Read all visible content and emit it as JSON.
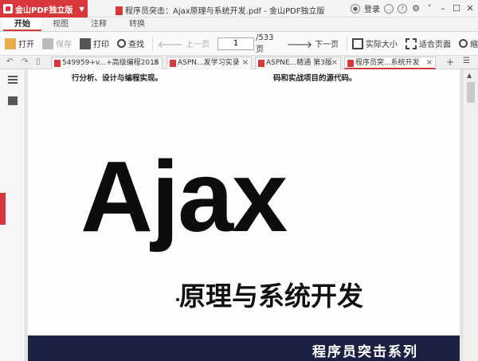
{
  "app": {
    "name": "金山PDF独立版",
    "window_title": "程序员突击：Ajax原理与系统开发.pdf - 金山PDF独立版",
    "login": "登录",
    "accent": "#d8383b"
  },
  "ribbon": {
    "tabs": [
      "开始",
      "视图",
      "注释",
      "转换"
    ],
    "active": "开始"
  },
  "toolbar": {
    "open": "打开",
    "save": "保存",
    "print": "打印",
    "find": "查找",
    "prev": "上一页",
    "page_current": "1",
    "page_total": "/533页",
    "next": "下一页",
    "actual_size": "实际大小",
    "fit_page": "适合页面",
    "zoom": "缩"
  },
  "doc_tabs": [
    {
      "label": "549959+v...+高级编程2015"
    },
    {
      "label": "ASPN...发学习实录"
    },
    {
      "label": "ASPNE...精通 第3版"
    },
    {
      "label": "程序员突...系统开发",
      "active": true
    }
  ],
  "document": {
    "header_left": "行分析、设计与编程实现。",
    "header_right": "码和实战项目的源代码。",
    "title": "Ajax",
    "subtitle": "原理与系统开发",
    "series": "程序员突击系列"
  },
  "icons": {
    "open": "folder-open-icon",
    "save": "save-icon",
    "print": "printer-icon",
    "find": "search-icon",
    "prev": "arrow-left-icon",
    "next": "arrow-right-icon",
    "actual_size": "actual-size-icon",
    "fit_page": "fit-page-icon",
    "zoom": "zoom-icon"
  }
}
